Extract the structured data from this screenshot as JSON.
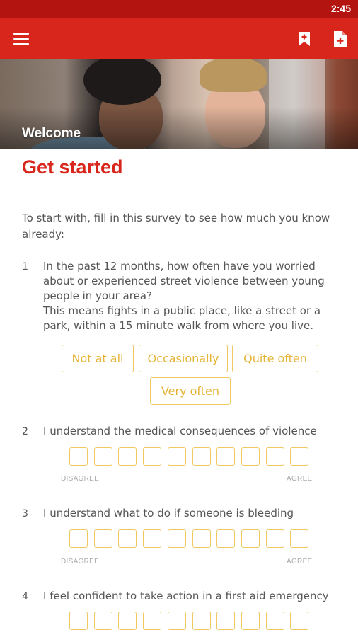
{
  "status_bar": {
    "time": "2:45"
  },
  "app_bar": {
    "menu_icon": "hamburger-menu-icon",
    "actions": [
      "bookmark-add-icon",
      "document-add-icon"
    ]
  },
  "hero": {
    "title": "Welcome"
  },
  "page": {
    "heading": "Get started",
    "intro": "To start with, fill in this survey to see how much you know already:"
  },
  "questions": [
    {
      "number": "1",
      "text": "In the past 12 months, how often have you worried about or experienced street violence between young people in your area?\nThis means fights in a public place, like a street or a park, within a 15 minute walk from where you live.",
      "options": [
        "Not at all",
        "Occasionally",
        "Quite often",
        "Very often"
      ]
    },
    {
      "number": "2",
      "text": "I understand the medical consequences of violence",
      "scale_left": "DISAGREE",
      "scale_right": "AGREE",
      "scale_points": 10
    },
    {
      "number": "3",
      "text": "I understand what to do if someone is bleeding",
      "scale_left": "DISAGREE",
      "scale_right": "AGREE",
      "scale_points": 10
    },
    {
      "number": "4",
      "text": "I feel confident to take action in a first aid emergency",
      "scale_points": 10
    }
  ],
  "colors": {
    "status_bar": "#b3140f",
    "app_bar": "#d9261c",
    "accent": "#d9261c",
    "option_border": "#f0c860",
    "option_text": "#e5b437"
  }
}
